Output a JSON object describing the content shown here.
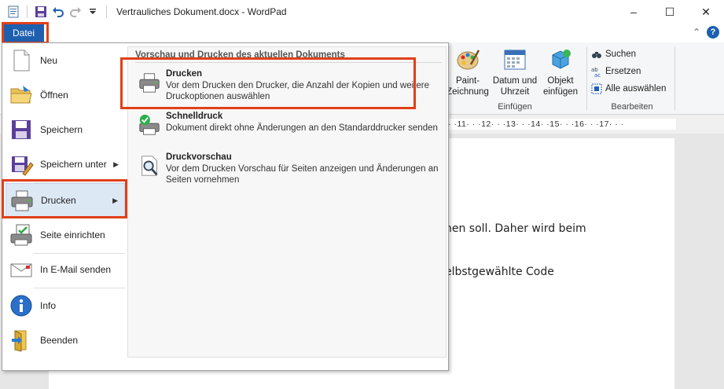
{
  "window": {
    "title": "Vertrauliches Dokument.docx - WordPad",
    "controls": {
      "minimize": "–",
      "maximize": "☐",
      "close": "✕"
    }
  },
  "ribbon": {
    "file_tab": "Datei",
    "collapse_glyph": "⌃",
    "help_glyph": "?",
    "insert_group": {
      "label": "Einfügen",
      "paint": "Paint-Zeichnung",
      "paint_line1": "Paint-",
      "paint_line2": "Zeichnung",
      "datetime_line1": "Datum und",
      "datetime_line2": "Uhrzeit",
      "object_line1": "Objekt",
      "object_line2": "einfügen"
    },
    "edit_group": {
      "label": "Bearbeiten",
      "find": "Suchen",
      "replace": "Ersetzen",
      "select_all": "Alle auswählen"
    }
  },
  "ruler": {
    "text": "· ·11· · ·12· · ·13· · ·14· ·15· · ·16· · ·17· · ·"
  },
  "document": {
    "line1": "hen soll. Daher wird beim",
    "line2": "elbstgewählte Code"
  },
  "file_menu": {
    "items": [
      {
        "label": "Neu",
        "icon": "new-document-icon"
      },
      {
        "label": "Öffnen",
        "icon": "open-folder-icon"
      },
      {
        "label": "Speichern",
        "icon": "save-icon"
      },
      {
        "label": "Speichern unter",
        "icon": "save-as-icon",
        "submenu": true
      },
      {
        "label": "Drucken",
        "icon": "printer-icon",
        "submenu": true,
        "active": true
      },
      {
        "label": "Seite einrichten",
        "icon": "page-setup-icon"
      },
      {
        "label": "In E-Mail senden",
        "icon": "email-icon"
      },
      {
        "label": "Info",
        "icon": "info-icon"
      },
      {
        "label": "Beenden",
        "icon": "exit-icon"
      }
    ],
    "print_panel": {
      "header": "Vorschau und Drucken des aktuellen Dokuments",
      "options": [
        {
          "title": "Drucken",
          "description": "Vor dem Drucken den Drucker, die Anzahl der Kopien und weitere Druckoptionen auswählen"
        },
        {
          "title": "Schnelldruck",
          "description": "Dokument direkt ohne Änderungen an den Standarddrucker senden"
        },
        {
          "title": "Druckvorschau",
          "description": "Vor dem Drucken Vorschau für Seiten anzeigen und Änderungen an Seiten vornehmen"
        }
      ]
    }
  },
  "colors": {
    "accent": "#1e5fb0",
    "highlight": "#e0401a",
    "active_item": "#dde8f5"
  }
}
